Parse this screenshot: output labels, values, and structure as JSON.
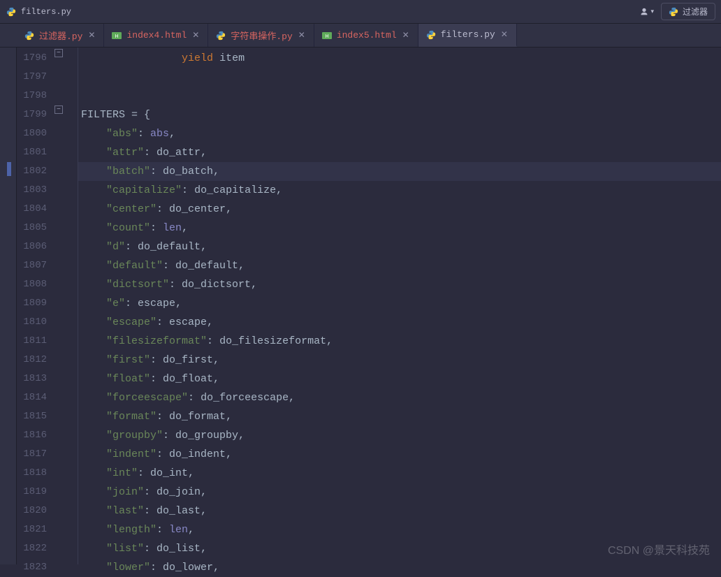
{
  "titlebar": {
    "filename": "filters.py",
    "run_label": "过滤器"
  },
  "tabs": [
    {
      "label": "过滤器.py",
      "type": "py",
      "active": false
    },
    {
      "label": "index4.html",
      "type": "html",
      "active": false
    },
    {
      "label": "字符串操作.py",
      "type": "py",
      "active": false
    },
    {
      "label": "index5.html",
      "type": "html",
      "active": false
    },
    {
      "label": "filters.py",
      "type": "py",
      "active": true
    }
  ],
  "gutter": {
    "start": 1796,
    "end": 1823,
    "current": 1802
  },
  "code": {
    "lines": [
      {
        "n": 1796,
        "indent": "                ",
        "tokens": [
          [
            "yield",
            "kw"
          ],
          [
            " ",
            ""
          ],
          [
            "item",
            "ident"
          ]
        ]
      },
      {
        "n": 1797,
        "indent": "",
        "tokens": []
      },
      {
        "n": 1798,
        "indent": "",
        "tokens": []
      },
      {
        "n": 1799,
        "indent": "",
        "tokens": [
          [
            "FILTERS",
            "ident"
          ],
          [
            " = {",
            "op"
          ]
        ]
      },
      {
        "n": 1800,
        "indent": "    ",
        "tokens": [
          [
            "\"abs\"",
            "str"
          ],
          [
            ": ",
            "op"
          ],
          [
            "abs",
            "builtin"
          ],
          [
            ",",
            "op"
          ]
        ]
      },
      {
        "n": 1801,
        "indent": "    ",
        "tokens": [
          [
            "\"attr\"",
            "str"
          ],
          [
            ": ",
            "op"
          ],
          [
            "do_attr",
            "ident"
          ],
          [
            ",",
            "op"
          ]
        ]
      },
      {
        "n": 1802,
        "indent": "    ",
        "tokens": [
          [
            "\"batch\"",
            "str"
          ],
          [
            ": ",
            "op"
          ],
          [
            "do_batch",
            "ident"
          ],
          [
            ",",
            "op"
          ]
        ]
      },
      {
        "n": 1803,
        "indent": "    ",
        "tokens": [
          [
            "\"capitalize\"",
            "str"
          ],
          [
            ": ",
            "op"
          ],
          [
            "do_capitalize",
            "ident"
          ],
          [
            ",",
            "op"
          ]
        ]
      },
      {
        "n": 1804,
        "indent": "    ",
        "tokens": [
          [
            "\"center\"",
            "str"
          ],
          [
            ": ",
            "op"
          ],
          [
            "do_center",
            "ident"
          ],
          [
            ",",
            "op"
          ]
        ]
      },
      {
        "n": 1805,
        "indent": "    ",
        "tokens": [
          [
            "\"count\"",
            "str"
          ],
          [
            ": ",
            "op"
          ],
          [
            "len",
            "builtin"
          ],
          [
            ",",
            "op"
          ]
        ]
      },
      {
        "n": 1806,
        "indent": "    ",
        "tokens": [
          [
            "\"d\"",
            "str"
          ],
          [
            ": ",
            "op"
          ],
          [
            "do_default",
            "ident"
          ],
          [
            ",",
            "op"
          ]
        ]
      },
      {
        "n": 1807,
        "indent": "    ",
        "tokens": [
          [
            "\"default\"",
            "str"
          ],
          [
            ": ",
            "op"
          ],
          [
            "do_default",
            "ident"
          ],
          [
            ",",
            "op"
          ]
        ]
      },
      {
        "n": 1808,
        "indent": "    ",
        "tokens": [
          [
            "\"dictsort\"",
            "str"
          ],
          [
            ": ",
            "op"
          ],
          [
            "do_dictsort",
            "ident"
          ],
          [
            ",",
            "op"
          ]
        ]
      },
      {
        "n": 1809,
        "indent": "    ",
        "tokens": [
          [
            "\"e\"",
            "str"
          ],
          [
            ": ",
            "op"
          ],
          [
            "escape",
            "ident"
          ],
          [
            ",",
            "op"
          ]
        ]
      },
      {
        "n": 1810,
        "indent": "    ",
        "tokens": [
          [
            "\"escape\"",
            "str"
          ],
          [
            ": ",
            "op"
          ],
          [
            "escape",
            "ident"
          ],
          [
            ",",
            "op"
          ]
        ]
      },
      {
        "n": 1811,
        "indent": "    ",
        "tokens": [
          [
            "\"filesizeformat\"",
            "str"
          ],
          [
            ": ",
            "op"
          ],
          [
            "do_filesizeformat",
            "ident"
          ],
          [
            ",",
            "op"
          ]
        ]
      },
      {
        "n": 1812,
        "indent": "    ",
        "tokens": [
          [
            "\"first\"",
            "str"
          ],
          [
            ": ",
            "op"
          ],
          [
            "do_first",
            "ident"
          ],
          [
            ",",
            "op"
          ]
        ]
      },
      {
        "n": 1813,
        "indent": "    ",
        "tokens": [
          [
            "\"float\"",
            "str"
          ],
          [
            ": ",
            "op"
          ],
          [
            "do_float",
            "ident"
          ],
          [
            ",",
            "op"
          ]
        ]
      },
      {
        "n": 1814,
        "indent": "    ",
        "tokens": [
          [
            "\"forceescape\"",
            "str"
          ],
          [
            ": ",
            "op"
          ],
          [
            "do_forceescape",
            "ident"
          ],
          [
            ",",
            "op"
          ]
        ]
      },
      {
        "n": 1815,
        "indent": "    ",
        "tokens": [
          [
            "\"format\"",
            "str"
          ],
          [
            ": ",
            "op"
          ],
          [
            "do_format",
            "ident"
          ],
          [
            ",",
            "op"
          ]
        ]
      },
      {
        "n": 1816,
        "indent": "    ",
        "tokens": [
          [
            "\"groupby\"",
            "str"
          ],
          [
            ": ",
            "op"
          ],
          [
            "do_groupby",
            "ident"
          ],
          [
            ",",
            "op"
          ]
        ]
      },
      {
        "n": 1817,
        "indent": "    ",
        "tokens": [
          [
            "\"indent\"",
            "str"
          ],
          [
            ": ",
            "op"
          ],
          [
            "do_indent",
            "ident"
          ],
          [
            ",",
            "op"
          ]
        ]
      },
      {
        "n": 1818,
        "indent": "    ",
        "tokens": [
          [
            "\"int\"",
            "str"
          ],
          [
            ": ",
            "op"
          ],
          [
            "do_int",
            "ident"
          ],
          [
            ",",
            "op"
          ]
        ]
      },
      {
        "n": 1819,
        "indent": "    ",
        "tokens": [
          [
            "\"join\"",
            "str"
          ],
          [
            ": ",
            "op"
          ],
          [
            "do_join",
            "ident"
          ],
          [
            ",",
            "op"
          ]
        ]
      },
      {
        "n": 1820,
        "indent": "    ",
        "tokens": [
          [
            "\"last\"",
            "str"
          ],
          [
            ": ",
            "op"
          ],
          [
            "do_last",
            "ident"
          ],
          [
            ",",
            "op"
          ]
        ]
      },
      {
        "n": 1821,
        "indent": "    ",
        "tokens": [
          [
            "\"length\"",
            "str"
          ],
          [
            ": ",
            "op"
          ],
          [
            "len",
            "builtin"
          ],
          [
            ",",
            "op"
          ]
        ]
      },
      {
        "n": 1822,
        "indent": "    ",
        "tokens": [
          [
            "\"list\"",
            "str"
          ],
          [
            ": ",
            "op"
          ],
          [
            "do_list",
            "ident"
          ],
          [
            ",",
            "op"
          ]
        ]
      },
      {
        "n": 1823,
        "indent": "    ",
        "tokens": [
          [
            "\"lower\"",
            "str"
          ],
          [
            ": ",
            "op"
          ],
          [
            "do_lower",
            "ident"
          ],
          [
            ",",
            "op"
          ]
        ]
      }
    ]
  },
  "watermark": "CSDN @景天科技苑"
}
